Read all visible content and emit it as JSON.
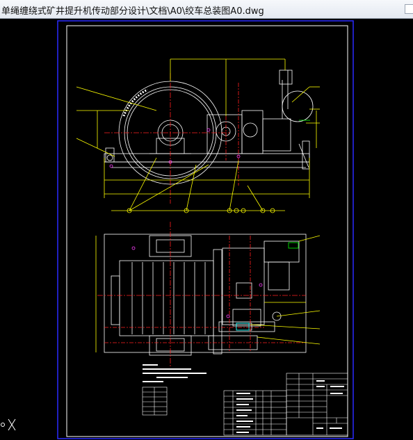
{
  "window": {
    "title": "单绳缠绕式矿井提升机传动部分设计\\文档\\A0\\绞车总装图A0.dwg"
  },
  "canvas": {
    "background": "#000000",
    "sheet_border_color": "#2020ff",
    "frame_color": "#ffffff",
    "line_colors": {
      "white": "#ffffff",
      "yellow": "#ffff00",
      "red": "#ff2020",
      "green": "#00ff00",
      "cyan": "#00ffff",
      "magenta": "#ff40ff"
    }
  },
  "icons": {
    "ucs_icon": "ucs-axis-icon"
  }
}
